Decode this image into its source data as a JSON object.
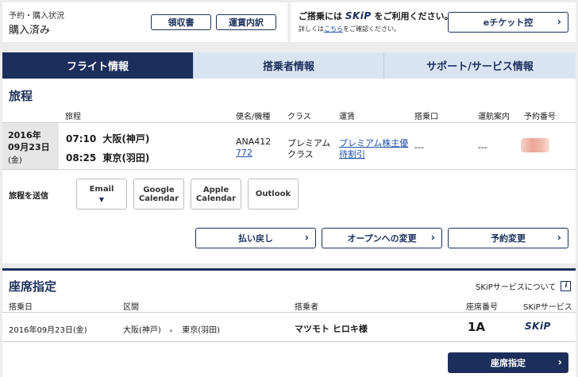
{
  "status": {
    "label": "予約・購入状況",
    "value": "購入済み",
    "receipt_button": "領収書",
    "fare_detail_button": "運賃内訳"
  },
  "skip_promo": {
    "prefix": "ご搭乗には",
    "logo": "SKiP",
    "suffix": "をご利用ください。",
    "detail_prefix": "詳しくは",
    "detail_link": "こちら",
    "detail_suffix": "をご確認ください。",
    "eticket_button": "eチケット控"
  },
  "tabs": [
    {
      "label": "フライト情報",
      "active": true
    },
    {
      "label": "搭乗者情報",
      "active": false
    },
    {
      "label": "サポート/サービス情報",
      "active": false
    }
  ],
  "itinerary": {
    "title": "旅程",
    "headers": {
      "route": "旅程",
      "flight": "便名/機種",
      "class": "クラス",
      "fare": "運賃",
      "gate": "搭乗口",
      "status": "運航案内",
      "booking": "予約番号"
    },
    "date_line1": "2016年",
    "date_line2": "09月23日",
    "date_line3": "(金)",
    "dep_time": "07:10",
    "dep_place": "大阪(神戸)",
    "arr_time": "08:25",
    "arr_place": "東京(羽田)",
    "flight_no": "ANA412",
    "aircraft": "772",
    "class_line1": "プレミアム",
    "class_line2": "クラス",
    "fare_line1": "プレミアム株主優",
    "fare_line2": "待割引",
    "gate": "---",
    "flight_status": "---"
  },
  "send": {
    "label": "旅程を送信",
    "email": "Email",
    "google_line1": "Google",
    "google_line2": "Calendar",
    "apple_line1": "Apple",
    "apple_line2": "Calendar",
    "outlook": "Outlook"
  },
  "actions": {
    "refund": "払い戻し",
    "open": "オープンへの変更",
    "change": "予約変更"
  },
  "seat": {
    "title": "座席指定",
    "skip_service_link": "SKiPサービスについて",
    "headers": {
      "date": "搭乗日",
      "route": "区間",
      "passenger": "搭乗者",
      "seat_no": "座席番号",
      "skip": "SKiPサービス"
    },
    "date": "2016年09月23日(金)",
    "from": "大阪(神戸)",
    "to": "東京(羽田)",
    "passenger": "マツモト ヒロキ様",
    "seat_no": "1A",
    "skip_logo": "SKiP",
    "seat_button": "座席指定"
  },
  "colors": {
    "navy": "#1c2f5c",
    "tab_inactive": "#d9e4f2",
    "link": "#1f4fa8"
  }
}
